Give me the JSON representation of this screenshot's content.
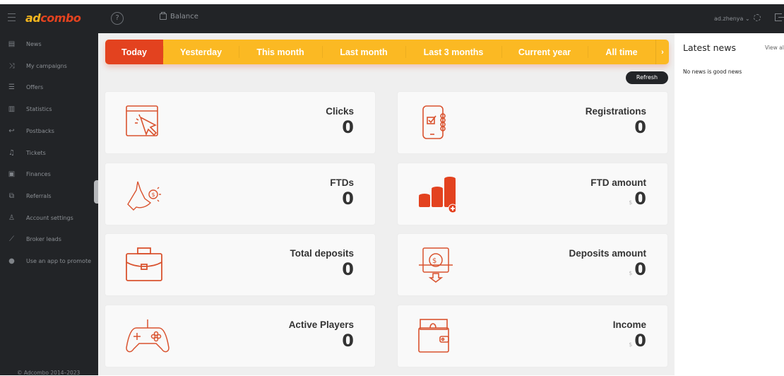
{
  "header": {
    "logo_left": "ad",
    "logo_right": "combo",
    "help": "?",
    "balance_label": "Balance",
    "user": "ad.zhenya"
  },
  "sidebar": {
    "items": [
      {
        "label": "News",
        "icon": "newspaper-icon",
        "glyph": "▤"
      },
      {
        "label": "My campaigns",
        "icon": "shuffle-icon",
        "glyph": "⤨"
      },
      {
        "label": "Offers",
        "icon": "list-icon",
        "glyph": "☰"
      },
      {
        "label": "Statistics",
        "icon": "bar-chart-icon",
        "glyph": "▥"
      },
      {
        "label": "Postbacks",
        "icon": "return-arrow-icon",
        "glyph": "↩"
      },
      {
        "label": "Tickets",
        "icon": "bell-icon",
        "glyph": "♫"
      },
      {
        "label": "Finances",
        "icon": "wallet-icon",
        "glyph": "▣"
      },
      {
        "label": "Referrals",
        "icon": "hierarchy-icon",
        "glyph": "⧉"
      },
      {
        "label": "Account settings",
        "icon": "user-icon",
        "glyph": "♙"
      },
      {
        "label": "Broker leads",
        "icon": "trend-chart-icon",
        "glyph": "⟋"
      },
      {
        "label": "Use an app to promote",
        "icon": "app-icon",
        "glyph": "●"
      }
    ],
    "footer": "© Adcombo 2014–2023"
  },
  "tabs": [
    {
      "label": "Today",
      "active": true
    },
    {
      "label": "Yesterday"
    },
    {
      "label": "This month"
    },
    {
      "label": "Last month"
    },
    {
      "label": "Last 3 months"
    },
    {
      "label": "Current year"
    },
    {
      "label": "All time"
    },
    {
      "label": "›"
    }
  ],
  "refresh_label": "Refresh",
  "cards": [
    {
      "title": "Clicks",
      "value": "0",
      "currency": "",
      "icon": "browser-click-icon"
    },
    {
      "title": "Registrations",
      "value": "0",
      "currency": "",
      "icon": "phone-checkbox-icon"
    },
    {
      "title": "FTDs",
      "value": "0",
      "currency": "",
      "icon": "hand-coin-icon"
    },
    {
      "title": "FTD amount",
      "value": "0",
      "currency": "$",
      "icon": "coin-stacks-icon"
    },
    {
      "title": "Total deposits",
      "value": "0",
      "currency": "",
      "icon": "briefcase-icon"
    },
    {
      "title": "Deposits amount",
      "value": "0",
      "currency": "$",
      "icon": "money-deposit-icon"
    },
    {
      "title": "Active Players",
      "value": "0",
      "currency": "",
      "icon": "gamepad-icon"
    },
    {
      "title": "Income",
      "value": "0",
      "currency": "$",
      "icon": "wallet-cash-icon"
    }
  ],
  "news": {
    "title": "Latest news",
    "view_all": "View all",
    "empty": "No news is good news"
  },
  "colors": {
    "accent_red": "#e3421f",
    "accent_yellow": "#fbb923",
    "dark": "#222427"
  }
}
